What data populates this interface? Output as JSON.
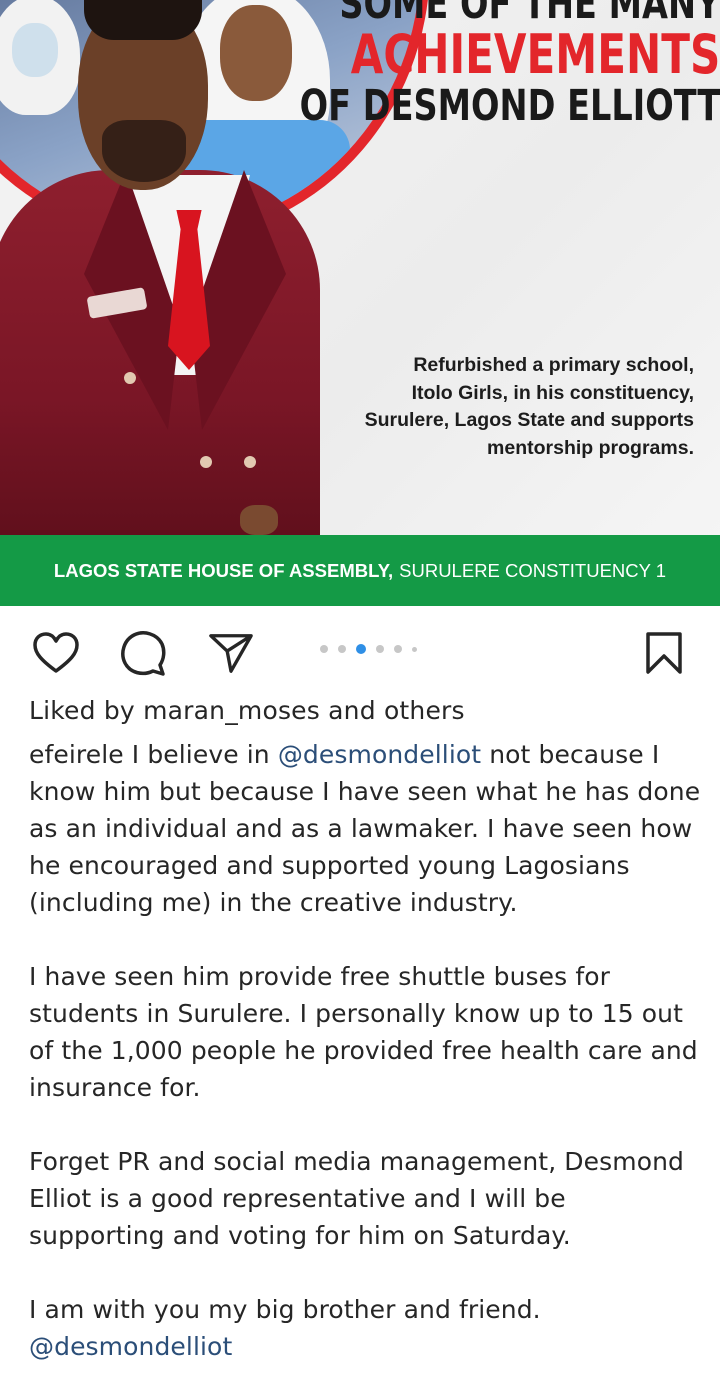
{
  "post_image": {
    "headline_line1": "SOME OF THE MANY",
    "headline_line2": "ACHIEVEMENTS",
    "headline_line3": "OF DESMOND ELLIOTT",
    "caption_lines": [
      "Refurbished a primary school,",
      "Itolo Girls, in his constituency,",
      "Surulere, Lagos State and supports",
      "mentorship programs."
    ],
    "banner_bold": "LAGOS STATE HOUSE OF ASSEMBLY,",
    "banner_regular": "SURULERE CONSTITUENCY 1",
    "colors": {
      "accent_red": "#e3262b",
      "banner_green": "#149a46",
      "suit_maroon": "#8e1f2e"
    }
  },
  "actions": {
    "icons": [
      "heart-icon",
      "comment-icon",
      "share-icon",
      "bookmark-icon"
    ],
    "carousel": {
      "count": 6,
      "active_index": 2
    },
    "active_dot_color": "#2f8fe6"
  },
  "likes": {
    "prefix": "Liked by",
    "user": "maran_moses",
    "middle": "and",
    "others": "others"
  },
  "caption": {
    "username": "efeirele",
    "p1_before": "I believe in",
    "mention": "@desmondelliot",
    "p1_after": "not because I know him but because I have seen what he has done as an individual and as a lawmaker. I have seen how he encouraged and supported young Lagosians (including me) in the creative industry.",
    "p2": "I have seen him provide free shuttle buses for students in Surulere. I personally know up to 15 out of the 1,000 people he provided free health care and insurance for.",
    "p3": "Forget PR and social media management, Desmond Elliot is a good representative and I will be supporting and voting for him on Saturday.",
    "p4": "I am with you my big brother and friend.",
    "end_mention": "@desmondelliot"
  }
}
